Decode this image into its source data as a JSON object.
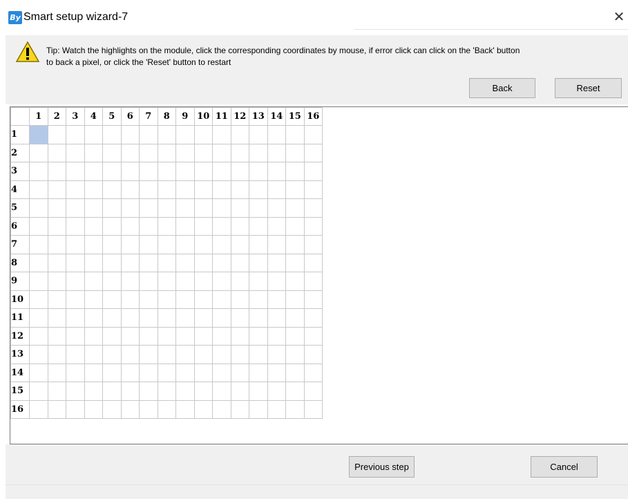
{
  "window": {
    "title": "Smart setup wizard-7",
    "app_icon_text": "By",
    "close_icon": "close-icon"
  },
  "tip": {
    "icon": "warning-icon",
    "line1": "Tip: Watch the highlights on the module, click the corresponding coordinates by mouse, if error click  can click on the 'Back' button",
    "line2": "to back a pixel, or click the 'Reset' button to restart"
  },
  "buttons": {
    "back": "Back",
    "reset": "Reset",
    "previous": "Previous step",
    "cancel": "Cancel"
  },
  "grid": {
    "columns": [
      "1",
      "2",
      "3",
      "4",
      "5",
      "6",
      "7",
      "8",
      "9",
      "10",
      "11",
      "12",
      "13",
      "14",
      "15",
      "16"
    ],
    "rows": [
      "1",
      "2",
      "3",
      "4",
      "5",
      "6",
      "7",
      "8",
      "9",
      "10",
      "11",
      "12",
      "13",
      "14",
      "15",
      "16"
    ],
    "selected_cell": {
      "row": 1,
      "col": 1
    },
    "selected_color": "#b4c9e8"
  },
  "colors": {
    "panel_bg": "#f0f0f0",
    "button_bg": "#e1e1e1",
    "grid_line": "#c8c8c8"
  }
}
